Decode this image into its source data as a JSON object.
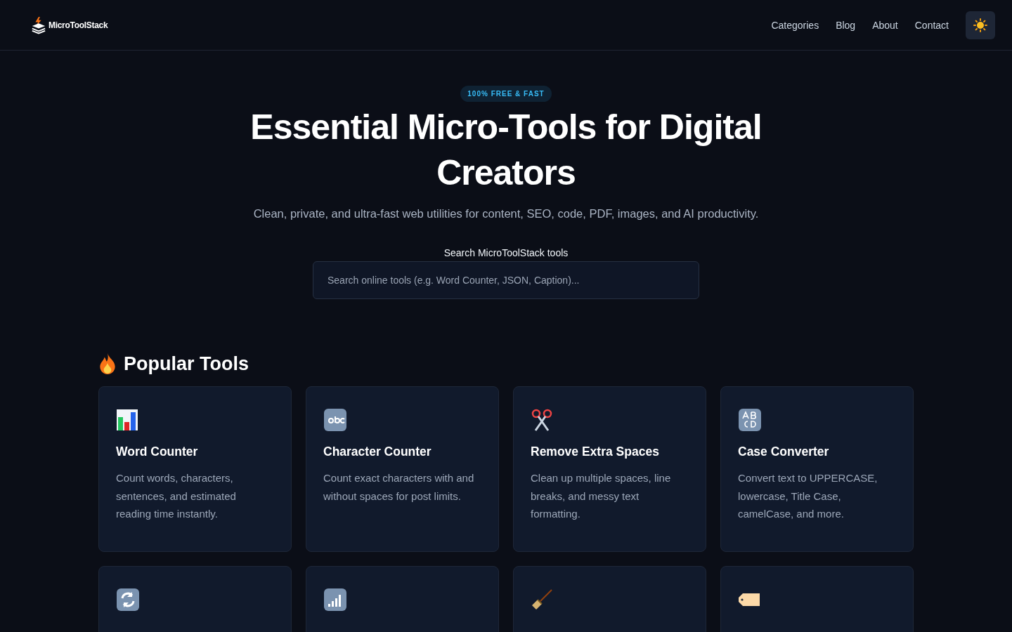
{
  "header": {
    "logo": "MicroToolStack",
    "nav": [
      "Categories",
      "Blog",
      "About",
      "Contact"
    ]
  },
  "hero": {
    "badge": "100% FREE & FAST",
    "title": "Essential Micro-Tools for Digital Creators",
    "subtitle": "Clean, private, and ultra-fast web utilities for content, SEO, code, PDF, images, and AI productivity.",
    "search_label": "Search MicroToolStack tools",
    "search": {
      "placeholder": "Search online tools (e.g. Word Counter, JSON, Caption)..."
    }
  },
  "popular": {
    "title": "Popular Tools",
    "cards": [
      {
        "kind": "chart",
        "title": "Word Counter",
        "description": "Count words, characters, sentences, and estimated reading time instantly."
      },
      {
        "kind": "abc",
        "title": "Character Counter",
        "description": "Count exact characters with and without spaces for post limits."
      },
      {
        "kind": "scissors",
        "title": "Remove Extra Spaces",
        "description": "Clean up multiple spaces, line breaks, and messy text formatting."
      },
      {
        "kind": "letters",
        "title": "Case Converter",
        "description": "Convert text to UPPERCASE, lowercase, Title Case, camelCase, and more."
      },
      {
        "kind": "refresh"
      },
      {
        "kind": "signal"
      },
      {
        "kind": "broom"
      },
      {
        "kind": "tag"
      }
    ]
  }
}
